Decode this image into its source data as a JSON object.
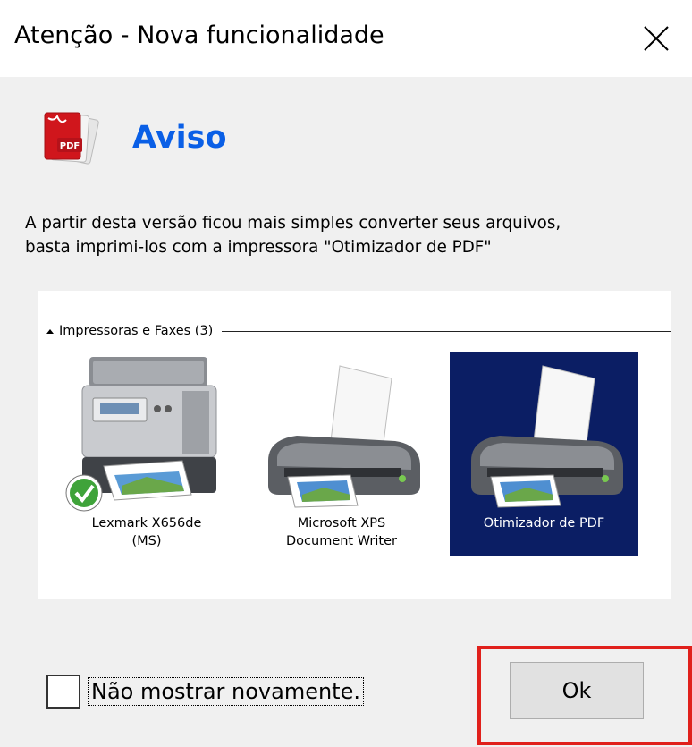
{
  "window": {
    "title": "Atenção - Nova funcionalidade",
    "close_icon": "close-icon"
  },
  "header": {
    "icon": "pdf-document-icon",
    "title": "Aviso",
    "title_color": "#0a5fe6"
  },
  "message": {
    "line1": "A partir desta versão ficou mais simples converter seus arquivos,",
    "line2": "basta imprimi-los com a impressora \"Otimizador de PDF\""
  },
  "printers_group": {
    "label": "Impressoras e Faxes (3)",
    "items": [
      {
        "name_line1": "Lexmark X656de",
        "name_line2": "(MS)",
        "icon": "multifunction-printer-icon",
        "default": true,
        "selected": false
      },
      {
        "name_line1": "Microsoft XPS",
        "name_line2": "Document Writer",
        "icon": "printer-icon",
        "default": false,
        "selected": false
      },
      {
        "name_line1": "Otimizador de PDF",
        "name_line2": "",
        "icon": "printer-icon",
        "default": false,
        "selected": true
      }
    ],
    "selection_color": "#0b1e64"
  },
  "footer": {
    "checkbox_label": "Não mostrar novamente.",
    "checkbox_checked": false,
    "ok_label": "Ok",
    "highlight_color": "#e0201b"
  }
}
